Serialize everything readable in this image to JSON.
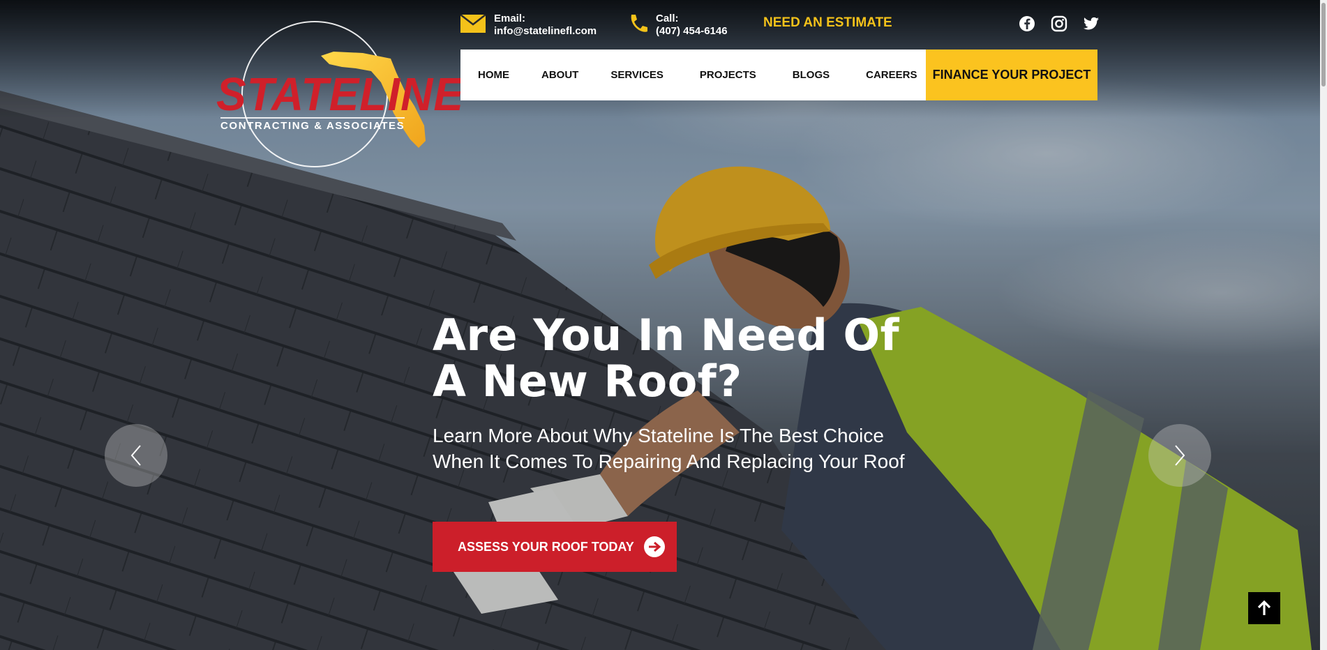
{
  "header": {
    "logo": {
      "name": "STATELINE",
      "sub": "CONTRACTING & ASSOCIATES",
      "emblem": "florida-map-icon"
    },
    "email": {
      "label": "Email:",
      "value": "info@statelinefl.com",
      "icon": "envelope-icon"
    },
    "call": {
      "label": "Call:",
      "value": "(407) 454-6146",
      "icon": "phone-icon"
    },
    "estimate_label": "NEED AN ESTIMATE",
    "social": [
      "facebook-icon",
      "instagram-icon",
      "twitter-icon"
    ]
  },
  "nav": {
    "items": [
      "HOME",
      "ABOUT",
      "SERVICES",
      "PROJECTS",
      "BLOGS",
      "CAREERS"
    ],
    "finance_label": "FINANCE YOUR PROJECT"
  },
  "hero": {
    "headline_line1": "Are You In Need Of",
    "headline_line2": "A New Roof?",
    "sub_line1": "Learn More About Why Stateline Is The Best Choice",
    "sub_line2": "When It Comes To Repairing And Replacing Your Roof",
    "cta_label": "ASSESS YOUR ROOF TODAY"
  },
  "colors": {
    "accent_yellow": "#fbc31f",
    "brand_red": "#cc1f2a",
    "estimate_gold": "#f4c21a"
  }
}
